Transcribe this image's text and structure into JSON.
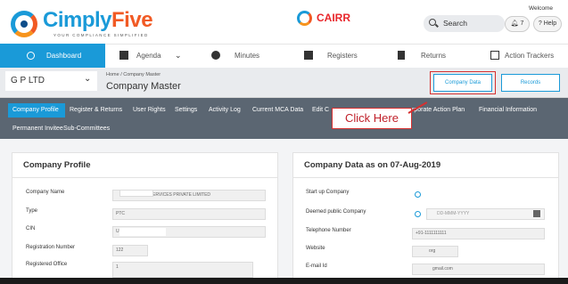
{
  "header": {
    "brand_part1": "Cimply",
    "brand_part2": "Five",
    "tagline": "YOUR COMPLIANCE SIMPLIFIED",
    "cairr_label": "CAIRR",
    "search_placeholder": "Search",
    "welcome": "Welcome",
    "notifications": "7",
    "help": "? Help"
  },
  "nav": [
    {
      "label": "Dashboard",
      "icon": "dashboard-icon",
      "active": true
    },
    {
      "label": "Agenda",
      "icon": "agenda-icon"
    },
    {
      "label": "Minutes",
      "icon": "minutes-icon"
    },
    {
      "label": "Registers",
      "icon": "registers-icon"
    },
    {
      "label": "Returns",
      "icon": "returns-icon"
    },
    {
      "label": "Action Trackers",
      "icon": "action-trackers-icon"
    }
  ],
  "company_bar": {
    "company_select": "G P LTD",
    "breadcrumb": "Home / Company Master",
    "title": "Company Master",
    "company_data_button": "Company Data",
    "records_button": "Records"
  },
  "tabs": [
    "Company Profile",
    "Register & Returns",
    "User Rights",
    "Settings",
    "Activity Log",
    "Current MCA Data",
    "Edit C",
    "rporate Action Plan",
    "Financial Information",
    "Permanent Invitee",
    "Sub-Committees"
  ],
  "callout": "Click Here",
  "profile": {
    "title": "Company Profile",
    "fields": [
      {
        "label": "Company Name",
        "value": "ERVICES PRIVATE LIMITED"
      },
      {
        "label": "Type",
        "value": "PTC"
      },
      {
        "label": "CIN",
        "value": "U7                                  85"
      },
      {
        "label": "Registration Number",
        "value": "122"
      },
      {
        "label": "Registered Office",
        "value": "1"
      }
    ]
  },
  "company_data": {
    "title": "Company Data as on 07-Aug-2019",
    "fields": [
      {
        "label": "Start up Company",
        "value": ""
      },
      {
        "label": "Deemed public Company",
        "value": "DD-MMM-YYYY"
      },
      {
        "label": "Telephone Number",
        "value": "+91-1111111111"
      },
      {
        "label": "Website",
        "value": "org"
      },
      {
        "label": "E-mail Id",
        "value": "gmail.com"
      }
    ]
  },
  "colors": {
    "accent": "#1a9ad8",
    "tabs_bg": "#5b6672",
    "highlight": "#d63030"
  }
}
